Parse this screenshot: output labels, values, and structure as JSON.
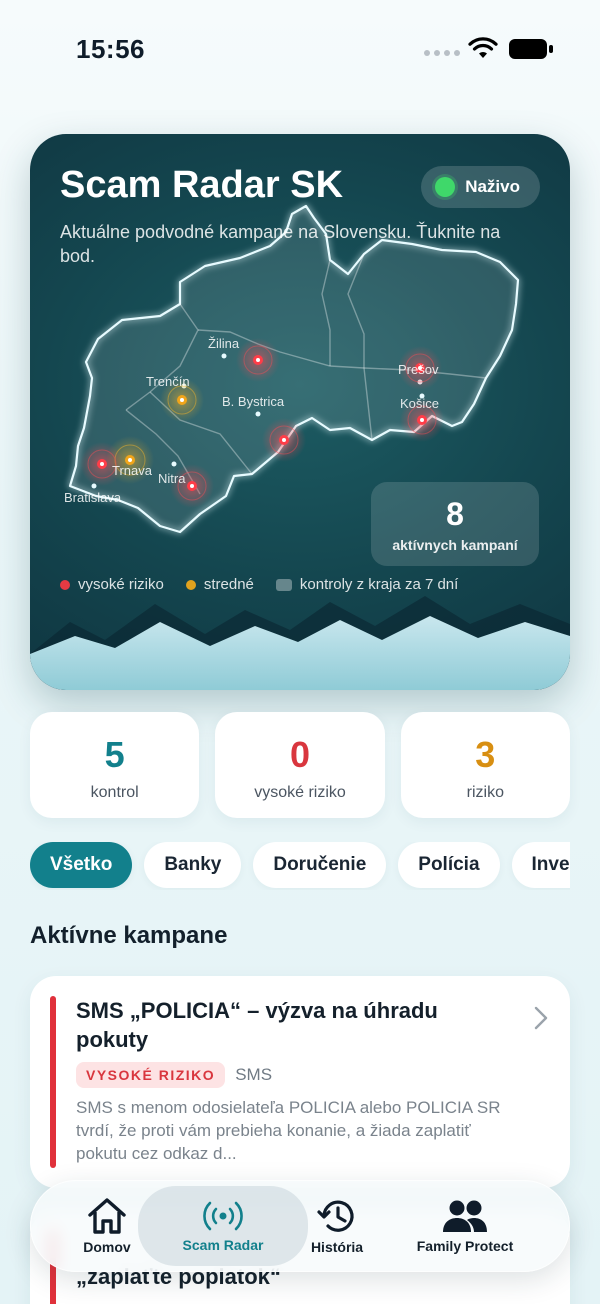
{
  "status_bar": {
    "time": "15:56"
  },
  "hero": {
    "title": "Scam Radar SK",
    "live_label": "Naživo",
    "subtitle": "Aktuálne podvodné kampane na Slovensku. Ťuknite na bod.",
    "cities": [
      "Žilina",
      "Trenčín",
      "B. Bystrica",
      "Prešov",
      "Košice",
      "Trnava",
      "Nitra",
      "Bratislava"
    ],
    "active_count": "8",
    "active_label": "aktívnych kampaní",
    "legend": {
      "high": "vysoké riziko",
      "medium": "stredné",
      "checks": "kontroly z kraja za 7 dní"
    },
    "colors": {
      "high": "#e43a43",
      "medium": "#e0a21e"
    }
  },
  "stats": [
    {
      "value": "5",
      "label": "kontrol",
      "color": "#12808c"
    },
    {
      "value": "0",
      "label": "vysoké riziko",
      "color": "#d9363e"
    },
    {
      "value": "3",
      "label": "riziko",
      "color": "#d88f12"
    }
  ],
  "filters": [
    "Všetko",
    "Banky",
    "Doručenie",
    "Polícia",
    "Investície"
  ],
  "section_title": "Aktívne kampane",
  "campaigns": [
    {
      "title": "SMS „POLICIA“ – výzva na úhradu pokuty",
      "risk": "VYSOKÉ RIZIKO",
      "channel": "SMS",
      "description": "SMS s menom odosielateľa POLICIA alebo POLICIA SR tvrdí, že proti vám prebieha konanie, a žiada zaplatiť pokutu cez odkaz d..."
    },
    {
      "title": "„zaplaťte poplatok“"
    }
  ],
  "tabbar": {
    "tabs": [
      {
        "label": "Domov",
        "icon": "home-icon"
      },
      {
        "label": "Scam Radar",
        "icon": "radar-icon"
      },
      {
        "label": "História",
        "icon": "history-icon"
      },
      {
        "label": "Family Protect",
        "icon": "family-icon"
      }
    ],
    "active_tab": "Scam Radar",
    "accent": "#12808c"
  }
}
